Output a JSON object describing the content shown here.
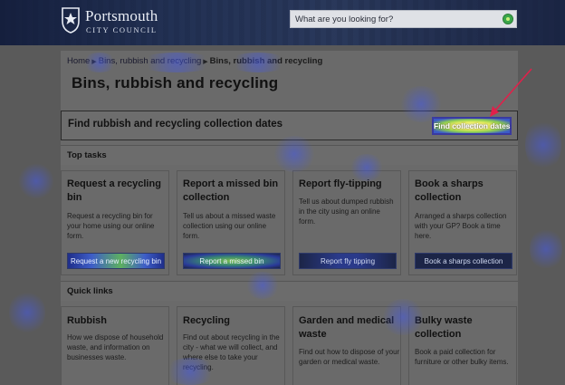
{
  "header": {
    "logo_name": "Portsmouth",
    "logo_sub": "CITY COUNCIL",
    "search_placeholder": "What are you looking for?",
    "colors": {
      "header_bg": "#1e2a44",
      "search_btn": "#3aa64a"
    }
  },
  "breadcrumb": {
    "items": [
      "Home",
      "Bins, rubbish and recycling"
    ],
    "current": "Bins, rubbish and recycling"
  },
  "page_title": "Bins, rubbish and recycling",
  "find_box": {
    "text": "Find rubbish and recycling collection dates",
    "button_label": "Find collection dates"
  },
  "top_tasks": {
    "heading": "Top tasks",
    "cards": [
      {
        "title": "Request a recycling bin",
        "desc": "Request a recycling bin for your home using our online form.",
        "button": "Request a new recycling bin"
      },
      {
        "title": "Report a missed bin collection",
        "desc": "Tell us about a missed waste collection using our online form.",
        "button": "Report a missed bin"
      },
      {
        "title": "Report fly-tipping",
        "desc": "Tell us about dumped rubbish in the city using an online form.",
        "button": "Report fly tipping"
      },
      {
        "title": "Book a sharps collection",
        "desc": "Arranged a sharps collection with your GP? Book a time here.",
        "button": "Book a sharps collection"
      }
    ]
  },
  "quick_links": {
    "heading": "Quick links",
    "cards": [
      {
        "title": "Rubbish",
        "desc": "How we dispose of household waste, and information on businesses waste."
      },
      {
        "title": "Recycling",
        "desc": "Find out about recycling in the city - what we will collect, and where else to take your recycling."
      },
      {
        "title": "Garden and medical waste",
        "desc": "Find out how to dispose of your garden or medical waste."
      },
      {
        "title": "Bulky waste collection",
        "desc": "Book a paid collection for furniture or other bulky items."
      }
    ]
  }
}
